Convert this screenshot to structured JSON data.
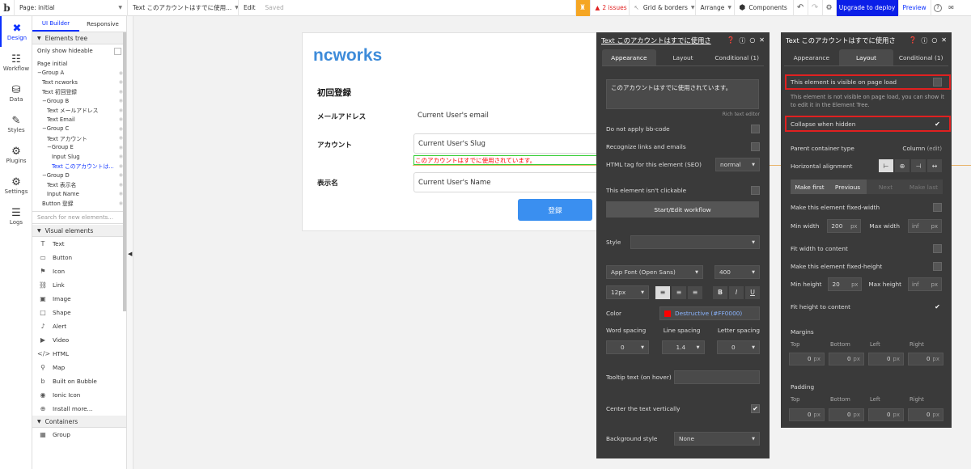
{
  "topbar": {
    "logo": "b",
    "page_selector": "Page: initial",
    "element_selector": "Text このアカウントはすでに使用...",
    "edit": "Edit",
    "saved": "Saved",
    "issues": "2 issues",
    "grid": "Grid & borders",
    "arrange": "Arrange",
    "components": "Components",
    "upgrade": "Upgrade to deploy",
    "preview": "Preview",
    "help": "?"
  },
  "leftnav": [
    {
      "label": "Design",
      "icon": "✖"
    },
    {
      "label": "Workflow",
      "icon": "☷"
    },
    {
      "label": "Data",
      "icon": "⛁"
    },
    {
      "label": "Styles",
      "icon": "✎"
    },
    {
      "label": "Plugins",
      "icon": "⚙"
    },
    {
      "label": "Settings",
      "icon": "⚙"
    },
    {
      "label": "Logs",
      "icon": "☰"
    }
  ],
  "sidepanel": {
    "tab_builder": "UI Builder",
    "tab_responsive": "Responsive",
    "tree_header": "Elements tree",
    "only_hideable": "Only show hideable",
    "tree": [
      {
        "label": "Page initial",
        "indent": 0
      },
      {
        "label": "−Group A",
        "indent": 0
      },
      {
        "label": "Text ncworks",
        "indent": 1
      },
      {
        "label": "Text 初回登録",
        "indent": 1
      },
      {
        "label": "−Group B",
        "indent": 1
      },
      {
        "label": "Text メールアドレス",
        "indent": 2
      },
      {
        "label": "Text Email",
        "indent": 2
      },
      {
        "label": "−Group C",
        "indent": 1
      },
      {
        "label": "Text アカウント",
        "indent": 2
      },
      {
        "label": "−Group E",
        "indent": 2
      },
      {
        "label": "Input Slug",
        "indent": 3
      },
      {
        "label": "Text このアカウントは...",
        "indent": 3
      },
      {
        "label": "−Group D",
        "indent": 1
      },
      {
        "label": "Text 表示名",
        "indent": 2
      },
      {
        "label": "Input Name",
        "indent": 2
      },
      {
        "label": "Button 登録",
        "indent": 1
      }
    ],
    "search_placeholder": "Search for new elements...",
    "visual_header": "Visual elements",
    "visual_items": [
      {
        "label": "Text",
        "icon": "T"
      },
      {
        "label": "Button",
        "icon": "▭"
      },
      {
        "label": "Icon",
        "icon": "⚑"
      },
      {
        "label": "Link",
        "icon": "⛓"
      },
      {
        "label": "Image",
        "icon": "▣"
      },
      {
        "label": "Shape",
        "icon": "□"
      },
      {
        "label": "Alert",
        "icon": "♪"
      },
      {
        "label": "Video",
        "icon": "▶"
      },
      {
        "label": "HTML",
        "icon": "</>"
      },
      {
        "label": "Map",
        "icon": "⚲"
      },
      {
        "label": "Built on Bubble",
        "icon": "b"
      },
      {
        "label": "Ionic Icon",
        "icon": "◉"
      },
      {
        "label": "Install more...",
        "icon": "⊕"
      }
    ],
    "containers_header": "Containers",
    "container_items": [
      {
        "label": "Group",
        "icon": "▦"
      }
    ]
  },
  "canvas": {
    "brand": "ncworks",
    "title": "初回登録",
    "email_label": "メールアドレス",
    "email_value": "Current User's email",
    "account_label": "アカウント",
    "slug_value": "Current User's Slug",
    "error_text": "このアカウントはすでに使用されています。",
    "name_label": "表示名",
    "name_value": "Current User's Name",
    "submit": "登録"
  },
  "editor1": {
    "title": "Text このアカウントはすでに使用さ",
    "tabs": [
      "Appearance",
      "Layout",
      "Conditional (1)"
    ],
    "text_content": "このアカウントはすでに使用されています。",
    "rich_text_editor": "Rich text editor",
    "no_bbcode": "Do not apply bb-code",
    "recognize_links": "Recognize links and emails",
    "html_tag_label": "HTML tag for this element (SEO)",
    "html_tag_value": "normal",
    "not_clickable": "This element isn't clickable",
    "workflow_btn": "Start/Edit workflow",
    "style_label": "Style",
    "font": "App Font (Open Sans)",
    "weight": "400",
    "size": "12px",
    "color_label": "Color",
    "color_value": "Destructive (#FF0000)",
    "color_hex": "#FF0000",
    "word_spacing_label": "Word spacing",
    "line_spacing_label": "Line spacing",
    "letter_spacing_label": "Letter spacing",
    "word_spacing": "0",
    "line_spacing": "1.4",
    "letter_spacing": "0",
    "tooltip_label": "Tooltip text (on hover)",
    "center_vertically": "Center the text vertically",
    "bg_style_label": "Background style",
    "bg_style_value": "None"
  },
  "editor2": {
    "title": "Text このアカウントはすでに使用さ",
    "tabs": [
      "Appearance",
      "Layout",
      "Conditional (1)"
    ],
    "visible_on_load": "This element is visible on page load",
    "not_visible_note": "This element is not visible on page load, you can show it to edit it in the Element Tree.",
    "collapse_hidden": "Collapse when hidden",
    "parent_type_label": "Parent container type",
    "parent_type_value": "Column",
    "parent_type_edit": "(edit)",
    "h_align_label": "Horizontal alignment",
    "make_first": "Make first",
    "previous": "Previous",
    "next": "Next",
    "make_last": "Make last",
    "fixed_width": "Make this element fixed-width",
    "min_width_label": "Min width",
    "min_width": "200",
    "max_width_label": "Max width",
    "max_width": "inf",
    "unit_px": "px",
    "fit_width": "Fit width to content",
    "fixed_height": "Make this element fixed-height",
    "min_height_label": "Min height",
    "min_height": "20",
    "max_height_label": "Max height",
    "max_height": "inf",
    "fit_height": "Fit height to content",
    "margins_label": "Margins",
    "padding_label": "Padding",
    "sides": [
      "Top",
      "Bottom",
      "Left",
      "Right"
    ],
    "zero": "0"
  },
  "colors": {
    "accent": "#0B30FF",
    "brand": "#3D8BD9",
    "error": "#FF0000",
    "highlight": "#E02020"
  }
}
